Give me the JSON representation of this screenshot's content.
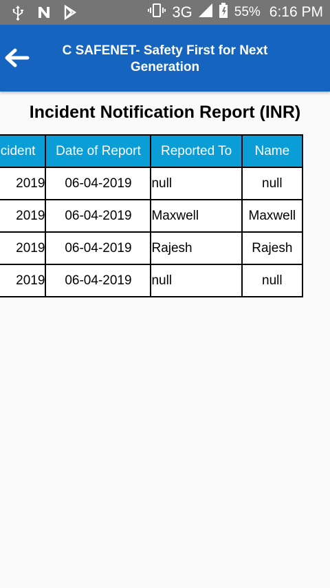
{
  "status_bar": {
    "network": "3G",
    "battery": "55%",
    "time": "6:16 PM",
    "icons": [
      "usb-icon",
      "n-notification-icon",
      "play-store-icon",
      "vibrate-icon",
      "signal-icon",
      "battery-icon"
    ]
  },
  "app_bar": {
    "title": "C SAFENET- Safety First for Next Generation",
    "back_icon": "arrow-left-icon"
  },
  "report": {
    "title": "Incident Notification Report (INR)",
    "columns": [
      "Incident",
      "Date of Report",
      "Reported To",
      "Name"
    ],
    "rows": [
      [
        "2019",
        "06-04-2019",
        "null",
        "null"
      ],
      [
        "2019",
        "06-04-2019",
        "Maxwell",
        "Maxwell"
      ],
      [
        "2019",
        "06-04-2019",
        "Rajesh",
        "Rajesh"
      ],
      [
        "2019",
        "06-04-2019",
        "null",
        "null"
      ]
    ]
  },
  "colors": {
    "app_bar": "#1565c0",
    "table_header": "#0b9dd6",
    "status_bar": "#757575",
    "background": "#fafafa"
  }
}
